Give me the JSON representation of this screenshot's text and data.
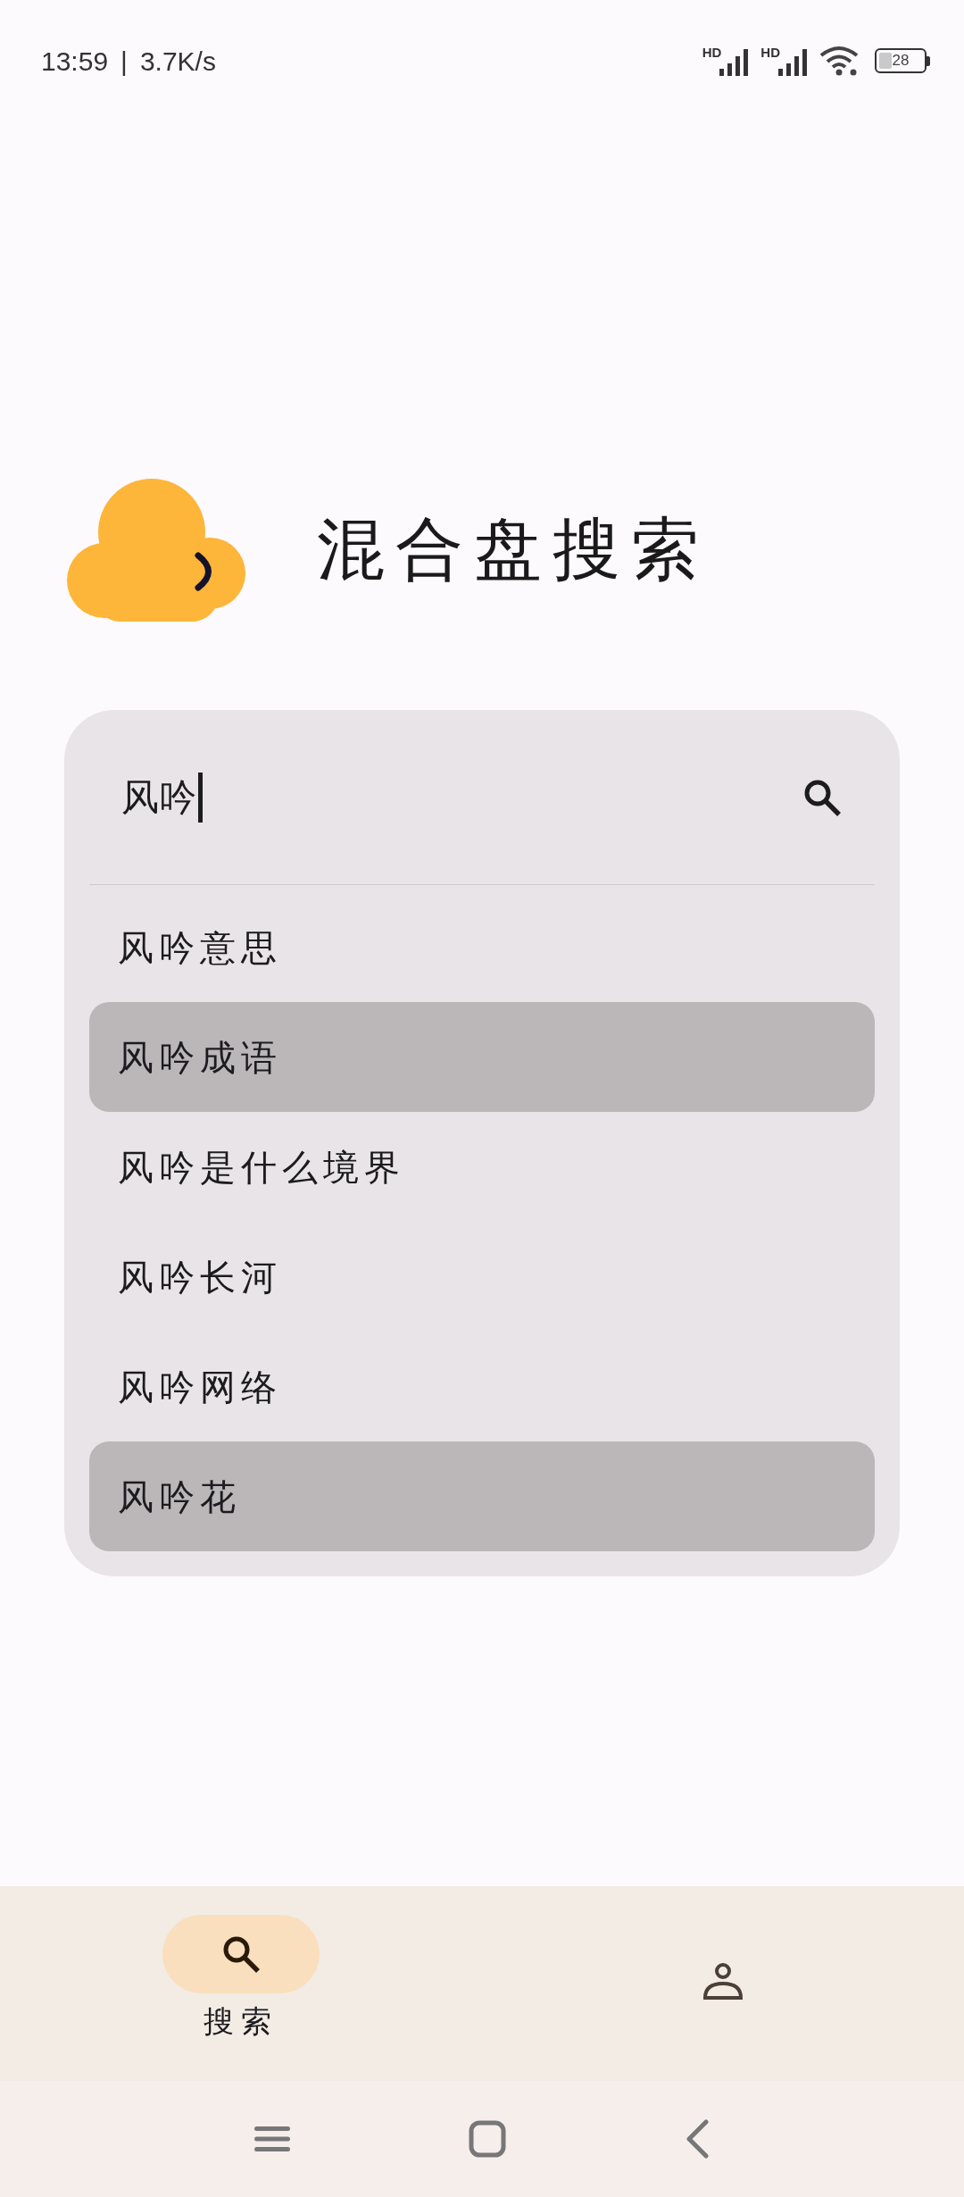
{
  "status_bar": {
    "time": "13:59",
    "separator": "|",
    "net_speed": "3.7K/s",
    "signal_labels": [
      "HD",
      "HD"
    ],
    "battery": "28"
  },
  "app": {
    "title": "混合盘搜索"
  },
  "search": {
    "value": "风吟",
    "suggestions": [
      {
        "text": "风吟意思",
        "highlighted": false
      },
      {
        "text": "风吟成语",
        "highlighted": true
      },
      {
        "text": "风吟是什么境界",
        "highlighted": false
      },
      {
        "text": "风吟长河",
        "highlighted": false
      },
      {
        "text": "风吟网络",
        "highlighted": false
      },
      {
        "text": "风吟花",
        "highlighted": true
      }
    ]
  },
  "bottom_nav": {
    "items": [
      {
        "kind": "search",
        "label": "搜索",
        "selected": true
      },
      {
        "kind": "profile",
        "selected": false
      }
    ]
  }
}
